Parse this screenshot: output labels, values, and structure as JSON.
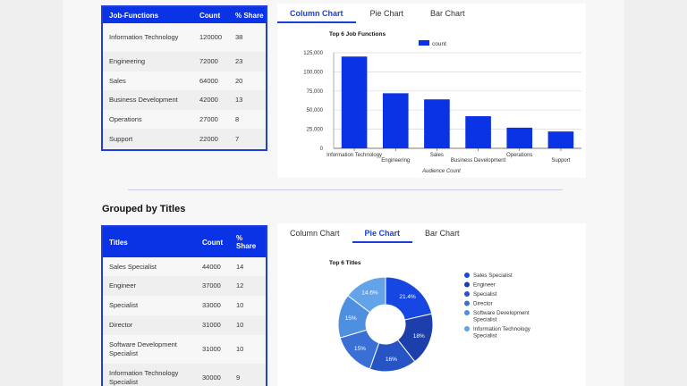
{
  "top_table": {
    "headers": [
      "Job-Functions",
      "Count",
      "% Share"
    ],
    "rows": [
      [
        "Information Technology",
        "120000",
        "38"
      ],
      [
        "Engineering",
        "72000",
        "23"
      ],
      [
        "Sales",
        "64000",
        "20"
      ],
      [
        "Business Development",
        "42000",
        "13"
      ],
      [
        "Operations",
        "27000",
        "8"
      ],
      [
        "Support",
        "22000",
        "7"
      ]
    ]
  },
  "top_tabs": [
    "Column Chart",
    "Pie Chart",
    "Bar Chart"
  ],
  "section2_title": "Grouped by Titles",
  "bottom_table": {
    "headers": [
      "Titles",
      "Count",
      "% Share"
    ],
    "rows": [
      [
        "Sales Specialist",
        "44000",
        "14"
      ],
      [
        "Engineer",
        "37000",
        "12"
      ],
      [
        "Specialist",
        "33000",
        "10"
      ],
      [
        "Director",
        "31000",
        "10"
      ],
      [
        "Software Development Specialist",
        "31000",
        "10"
      ],
      [
        "Information Technology Specialist",
        "30000",
        "9"
      ]
    ]
  },
  "bottom_tabs": [
    "Column Chart",
    "Pie Chart",
    "Bar Chart"
  ],
  "colors": {
    "brand": "#0a33e6",
    "bar": "#0a33e6"
  },
  "chart_data": [
    {
      "type": "bar",
      "title": "Top 6 Job Functions",
      "categories": [
        "Information Technology",
        "Engineering",
        "Sales",
        "Business Development",
        "Operations",
        "Support"
      ],
      "series": [
        {
          "name": "count",
          "values": [
            120000,
            72000,
            64000,
            42000,
            27000,
            22000
          ]
        }
      ],
      "xlabel": "Audience Count",
      "ylabel": "",
      "ylim": [
        0,
        125000
      ],
      "yticks": [
        "0",
        "25,000",
        "50,000",
        "75,000",
        "100,000",
        "125,000"
      ],
      "grid": true,
      "legend": "top"
    },
    {
      "type": "pie",
      "title": "Top 6 Titles",
      "labels": [
        "Sales Specialist",
        "Engineer",
        "Specialist",
        "Director",
        "Software Development Specialist",
        "Information Technology Specialist"
      ],
      "values": [
        21.4,
        18,
        16,
        15,
        15,
        14.6
      ],
      "value_labels": [
        "21.4%",
        "18%",
        "16%",
        "15%",
        "15%",
        "14.6%"
      ],
      "colors": [
        "#1747e3",
        "#1d3fab",
        "#2754c4",
        "#3a6fd6",
        "#4f8fe0",
        "#63a3ea"
      ],
      "legend": "right"
    }
  ]
}
